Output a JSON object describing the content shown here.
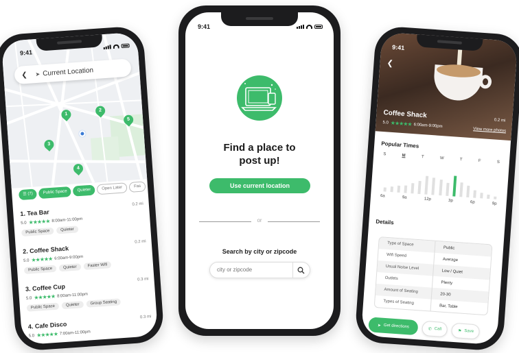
{
  "colors": {
    "accent": "#3dbb6b",
    "map_bg": "#eef0f3",
    "user_dot": "#3a7bd5"
  },
  "status_time": "9:41",
  "left_phone": {
    "search_bar": {
      "back_icon": "chevron-left-icon",
      "location_icon": "navigation-arrow-icon",
      "label": "Current Location"
    },
    "map_pins": [
      "1",
      "2",
      "3",
      "4",
      "5"
    ],
    "filters": {
      "settings_count": "(7)",
      "chips": [
        "Public Space",
        "Quieter",
        "Open Later",
        "Fas"
      ]
    },
    "results": [
      {
        "name": "1. Tea Bar",
        "dist": "0.2 mi",
        "rating": "5.0",
        "stars": "★★★★★",
        "hours": "8:00am-11:00pm",
        "tags": [
          "Public Space",
          "Quieter"
        ]
      },
      {
        "name": "2. Coffee Shack",
        "dist": "0.2 mi",
        "rating": "5.0",
        "stars": "★★★★★",
        "hours": "6:00am-9:00pm",
        "tags": [
          "Public Space",
          "Quieter",
          "Faster Wifi"
        ]
      },
      {
        "name": "3. Coffee Cup",
        "dist": "0.3 mi",
        "rating": "5.0",
        "stars": "★★★★★",
        "hours": "8:00am-11:00pm",
        "tags": [
          "Public Space",
          "Quieter",
          "Group Seating"
        ]
      },
      {
        "name": "4. Cafe Disco",
        "dist": "0.3 mi",
        "rating": "5.0",
        "stars": "★★★★★",
        "hours": "7:00am-11:00pm",
        "tags": []
      }
    ]
  },
  "center_phone": {
    "title_line1": "Find a place to",
    "title_line2": "post up!",
    "use_location_button": "Use current location",
    "or_text": "or",
    "search_label": "Search by city or zipcode",
    "search_placeholder": "city or zipcode"
  },
  "right_phone": {
    "name": "Coffee Shack",
    "dist": "0.2 mi",
    "rating": "5.0",
    "stars": "★★★★★",
    "hours": "6:00am-9:00pm",
    "more_photos": "View more photos",
    "popular_times_title": "Popular Times",
    "days": [
      "S",
      "M",
      "T",
      "W",
      "T",
      "F",
      "S"
    ],
    "hour_labels": [
      "6a",
      "9a",
      "12p",
      "3p",
      "6p",
      "9p"
    ],
    "popularity": [
      0.15,
      0.2,
      0.25,
      0.3,
      0.4,
      0.5,
      0.7,
      0.65,
      0.6,
      0.5,
      0.8,
      0.55,
      0.45,
      0.3,
      0.2,
      0.15,
      0.1
    ],
    "highlight_index": 10,
    "details_title": "Details",
    "details": [
      {
        "k": "Type of Space",
        "v": "Public"
      },
      {
        "k": "Wifi Speed",
        "v": "Average"
      },
      {
        "k": "Usual Noise Level",
        "v": "Low / Quiet"
      },
      {
        "k": "Outlets",
        "v": "Plenty"
      },
      {
        "k": "Amount of Seating",
        "v": "20-30"
      },
      {
        "k": "Types of Seating",
        "v": "Bar, Table"
      }
    ],
    "actions": {
      "directions": "Get directions",
      "call": "Call",
      "save": "Save"
    }
  }
}
